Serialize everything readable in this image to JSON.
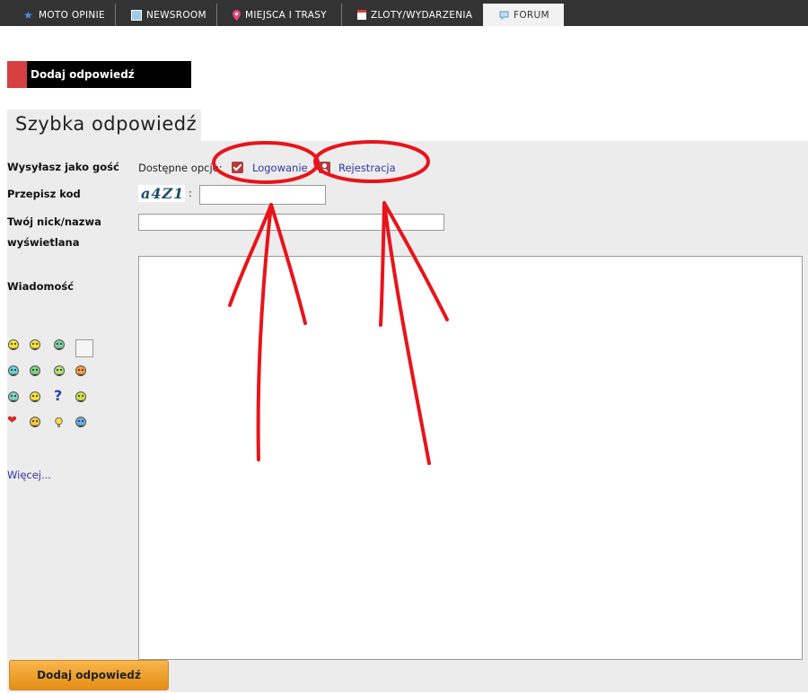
{
  "nav": {
    "tabs": [
      {
        "label": "MOTO OPINIE",
        "icon": "star-icon"
      },
      {
        "label": "NEWSROOM",
        "icon": "newspaper-icon"
      },
      {
        "label": "MIEJSCA I TRASY",
        "icon": "map-pin-icon"
      },
      {
        "label": "ZLOTY/WYDARZENIA",
        "icon": "calendar-icon"
      },
      {
        "label": "FORUM",
        "icon": "speech-bubble-icon"
      }
    ],
    "active": "FORUM"
  },
  "add_reply_bar": "Dodaj odpowiedź",
  "quick_reply_title": "Szybka odpowiedź",
  "form": {
    "guest_label": "Wysyłasz jako gość",
    "options_text": "Dostępne opcje:",
    "login_link": "Logowanie",
    "register_link": "Rejestracja",
    "code_label": "Przepisz kod",
    "captcha_text": "a4Z1",
    "captcha_colon": ":",
    "nick_label_line1": "Twój nick/nazwa",
    "nick_label_line2": "wyświetlana",
    "message_label": "Wiadomość",
    "more_link": "Więcej..."
  },
  "submit_label": "Dodaj odpowiedź",
  "colors": {
    "nav_bg": "#333333",
    "accent_red": "#d64040",
    "link_blue": "#3333aa",
    "annotation_red": "#e8141b",
    "button_orange": "#f0a030"
  }
}
